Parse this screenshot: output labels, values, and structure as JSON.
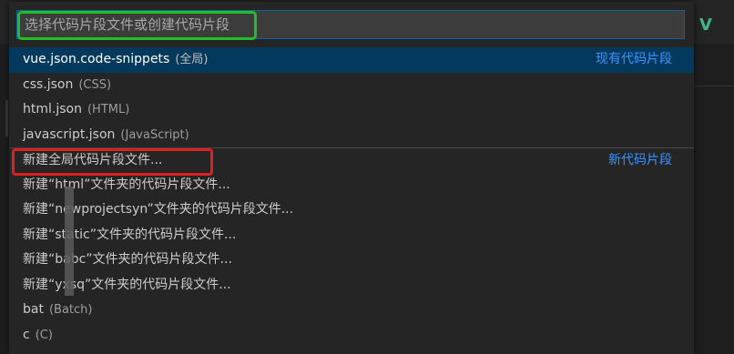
{
  "quick_pick": {
    "placeholder": "选择代码片段文件或创建代码片段",
    "existing_group_label": "现有代码片段",
    "new_group_label": "新代码片段",
    "existing": [
      {
        "label": "vue.json.code-snippets",
        "desc": "(全局)"
      },
      {
        "label": "css.json",
        "desc": "(CSS)"
      },
      {
        "label": "html.json",
        "desc": "(HTML)"
      },
      {
        "label": "javascript.json",
        "desc": "(JavaScript)"
      }
    ],
    "new_items": [
      {
        "label": "新建全局代码片段文件..."
      },
      {
        "label": "新建“html”文件夹的代码片段文件..."
      },
      {
        "label": "新建“newprojectsyn”文件夹的代码片段文件..."
      },
      {
        "label": "新建“static”文件夹的代码片段文件..."
      },
      {
        "label": "新建“babc”文件夹的代码片段文件..."
      },
      {
        "label": "新建“yxsq”文件夹的代码片段文件..."
      },
      {
        "label": "bat",
        "desc": "(Batch)"
      },
      {
        "label": "c",
        "desc": "(C)"
      }
    ]
  },
  "colors": {
    "highlight_input": "#1fbf25",
    "highlight_item": "#e02020",
    "accent_link": "#3794ff",
    "selected_row": "#04395e"
  },
  "icons": {
    "vue_logo": "vue-logo-icon"
  }
}
